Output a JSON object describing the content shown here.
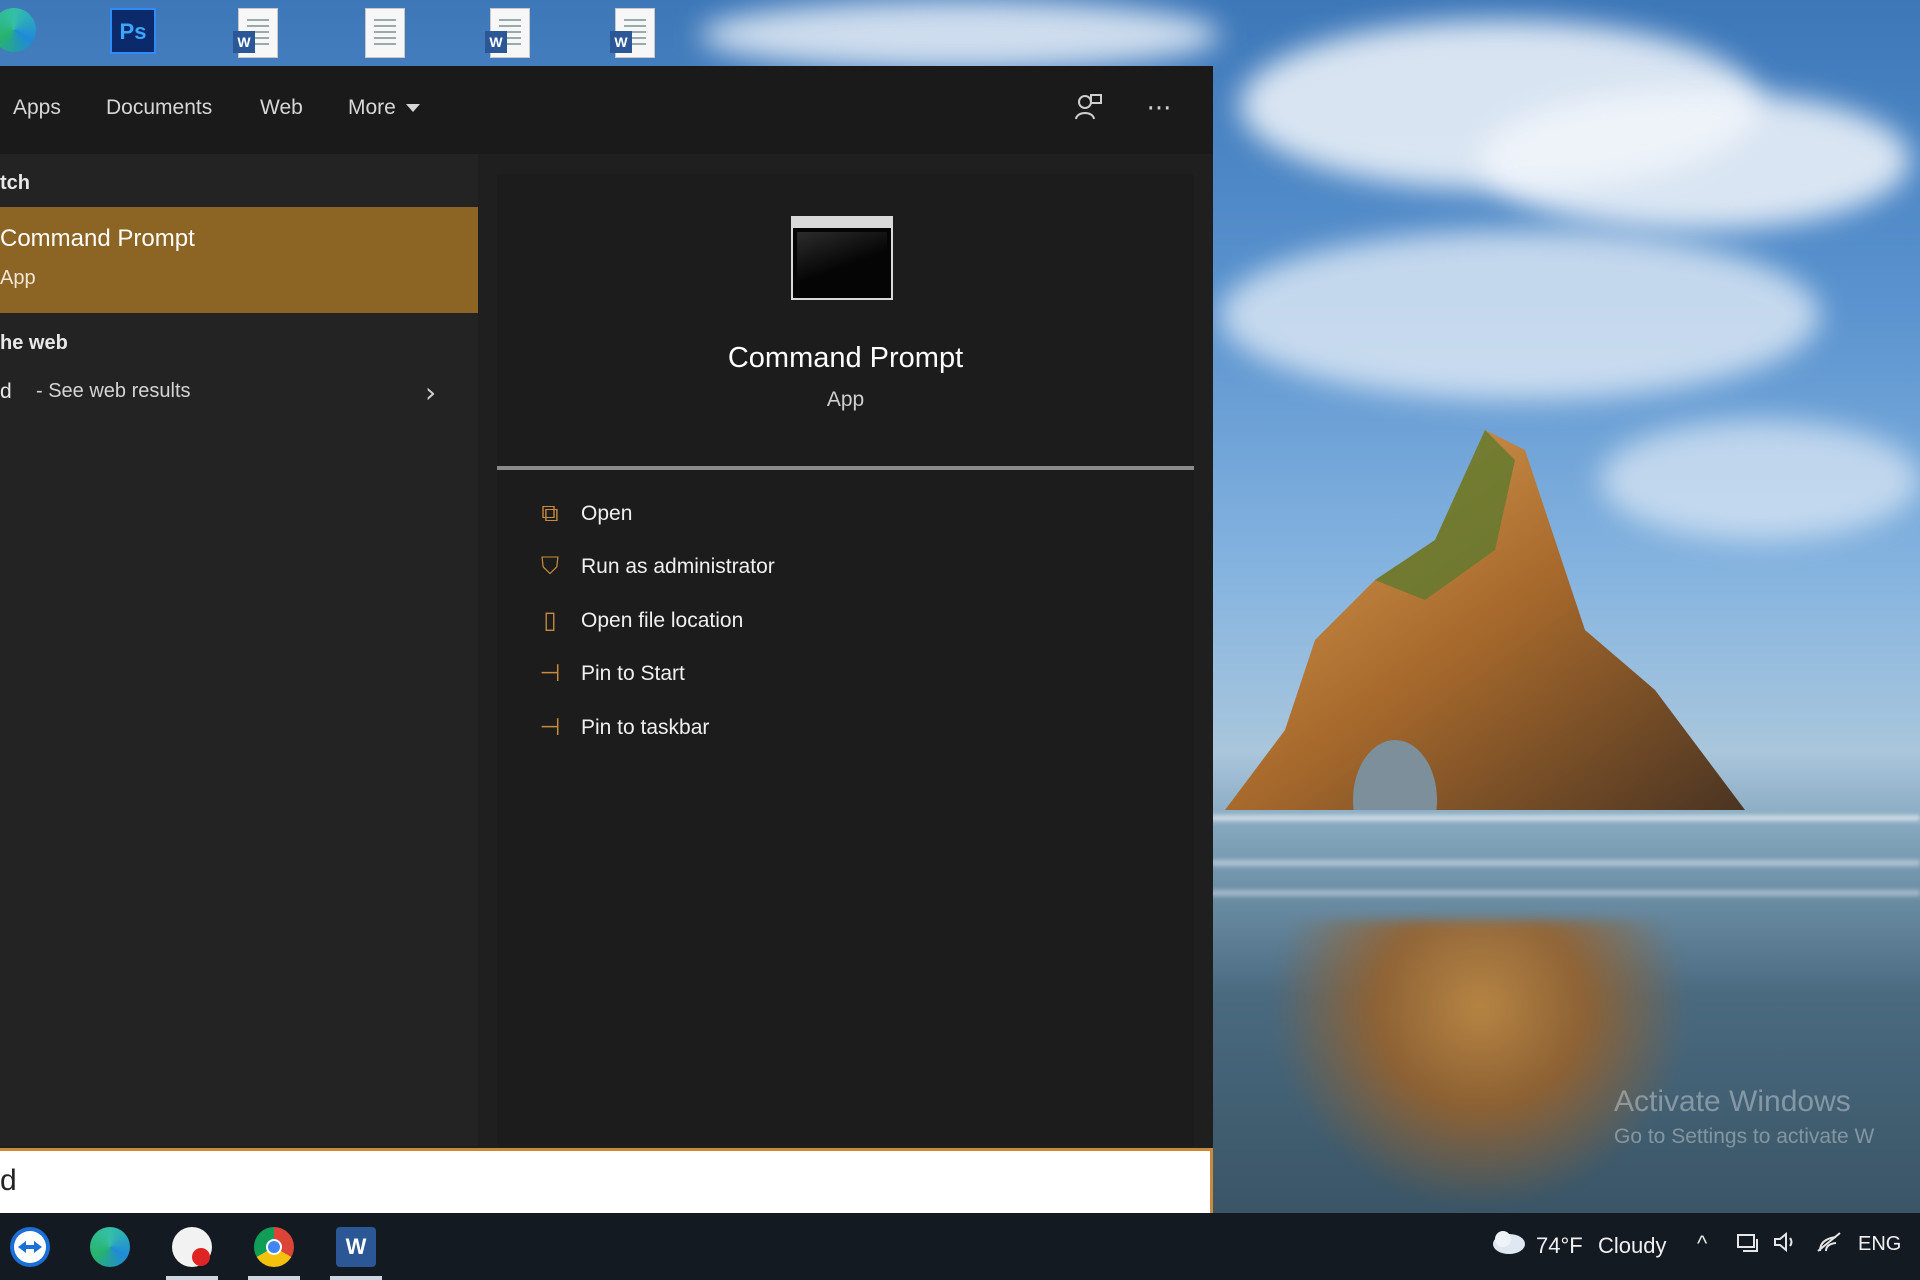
{
  "filter_bar": {
    "tabs": [
      "Apps",
      "Documents",
      "Web",
      "More"
    ],
    "feedback_icon": "feedback-icon",
    "more_options_icon": "ellipsis-icon",
    "more_options_glyph": "···"
  },
  "results": {
    "best_match_label": "tch",
    "best_match": {
      "title": "Command Prompt",
      "subtitle": "App"
    },
    "web_label": "he web",
    "web_query": "d",
    "web_see": "- See web results",
    "web_chevron": "›"
  },
  "detail": {
    "app_name": "Command Prompt",
    "app_type": "App",
    "actions": [
      {
        "label": "Open",
        "icon": "open-icon",
        "glyph": "⧉"
      },
      {
        "label": "Run as administrator",
        "icon": "shield-icon",
        "glyph": "⛉"
      },
      {
        "label": "Open file location",
        "icon": "file-location-icon",
        "glyph": "▯"
      },
      {
        "label": "Pin to Start",
        "icon": "pin-icon",
        "glyph": "⊣"
      },
      {
        "label": "Pin to taskbar",
        "icon": "pin-icon",
        "glyph": "⊣"
      }
    ]
  },
  "search": {
    "value": "d"
  },
  "desktop": {
    "ps_label": "Ps",
    "word_label": "W",
    "watermark_title": "Activate Windows",
    "watermark_sub": "Go to Settings to activate W"
  },
  "taskbar": {
    "apps": [
      "teamviewer-icon",
      "edge-icon",
      "messaging-icon",
      "chrome-icon",
      "word-icon"
    ],
    "word_label": "W",
    "weather": "74°F",
    "weather_desc": "Cloudy",
    "language": "ENG",
    "tray_up": "^"
  },
  "colors": {
    "accent": "#c98b3b",
    "best_match_bg": "#8c6424",
    "panel_bg": "#1f1f1f"
  }
}
